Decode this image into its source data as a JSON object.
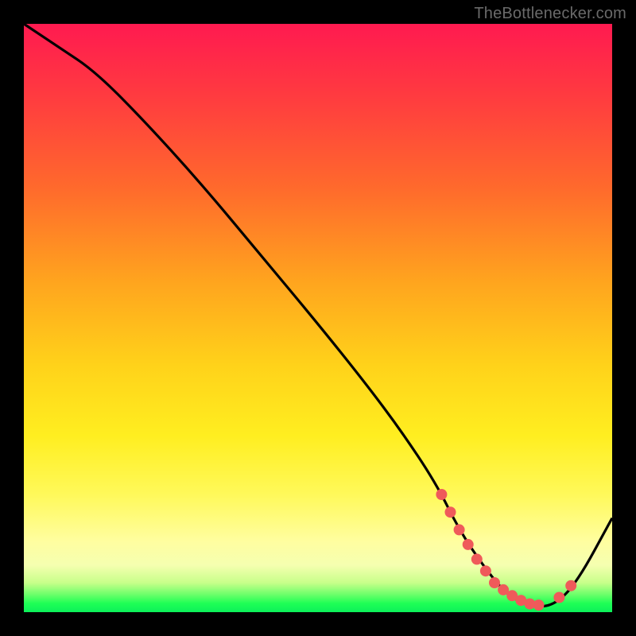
{
  "watermark": "TheBottlenecker.com",
  "colors": {
    "gradient_top": "#ff1a50",
    "gradient_mid": "#ffee20",
    "gradient_bottom": "#0cf05a",
    "curve": "#000000",
    "marker": "#ef5a5a",
    "frame_bg": "#000000"
  },
  "chart_data": {
    "type": "line",
    "title": "",
    "xlabel": "",
    "ylabel": "",
    "xlim": [
      0,
      100
    ],
    "ylim": [
      0,
      100
    ],
    "series": [
      {
        "name": "bottleneck-curve",
        "x": [
          0,
          6,
          12,
          20,
          30,
          40,
          50,
          58,
          64,
          70,
          74,
          78,
          82,
          86,
          90,
          94,
          100
        ],
        "y": [
          100,
          96,
          92,
          84,
          73,
          61,
          49,
          39,
          31,
          22,
          14,
          8,
          3,
          1,
          1,
          5,
          16
        ]
      }
    ],
    "markers": {
      "name": "highlighted-range",
      "x": [
        71,
        72.5,
        74,
        75.5,
        77,
        78.5,
        80,
        81.5,
        83,
        84.5,
        86,
        87.5,
        91,
        93
      ],
      "y": [
        20,
        17,
        14,
        11.5,
        9,
        7,
        5,
        3.8,
        2.8,
        2,
        1.4,
        1.2,
        2.5,
        4.5
      ]
    }
  }
}
